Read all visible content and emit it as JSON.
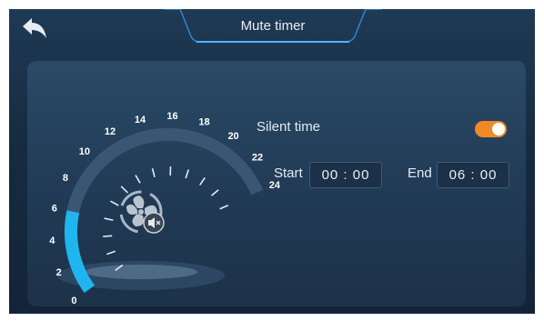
{
  "header": {
    "title": "Mute timer",
    "back_icon": "back-arrow-icon"
  },
  "gauge": {
    "ticks": [
      "0",
      "2",
      "4",
      "6",
      "8",
      "10",
      "12",
      "14",
      "16",
      "18",
      "20",
      "22",
      "24"
    ],
    "active_range": [
      0,
      6
    ],
    "center_icon": "fan-mute-icon",
    "accent_color": "#1fb6f0"
  },
  "silent": {
    "label": "Silent time",
    "enabled": true,
    "toggle_color": "#f08a24"
  },
  "start": {
    "label": "Start",
    "value": "00 : 00"
  },
  "end": {
    "label": "End",
    "value": "06 : 00"
  }
}
